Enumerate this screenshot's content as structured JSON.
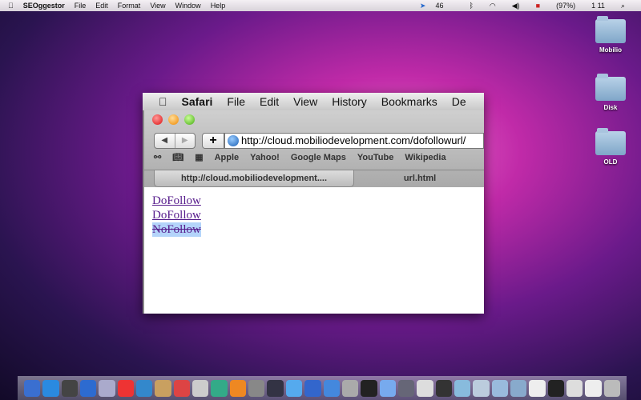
{
  "menubar": {
    "app": "SEOggestor",
    "items": [
      "File",
      "Edit",
      "Format",
      "View",
      "Window",
      "Help"
    ],
    "status": {
      "count": "46",
      "battery": "(97%)",
      "time": "1 11"
    }
  },
  "desktop": {
    "icons": [
      "Mobilio",
      "Disk",
      "OLD"
    ]
  },
  "safari": {
    "menu": [
      "Safari",
      "File",
      "Edit",
      "View",
      "History",
      "Bookmarks",
      "De"
    ],
    "url": "http://cloud.mobiliodevelopment.com/dofollowurl/",
    "bookmarks": [
      "Apple",
      "Yahoo!",
      "Google Maps",
      "YouTube",
      "Wikipedia"
    ],
    "tabs": [
      "http://cloud.mobiliodevelopment....",
      "url.html"
    ],
    "links": [
      "DoFollow",
      "DoFollow",
      "NoFollow"
    ]
  },
  "dock_colors": [
    "#3a6fd0",
    "#2a8ae0",
    "#444",
    "#2d6bd0",
    "#aac",
    "#e33",
    "#38c",
    "#c9a060",
    "#d44",
    "#ccc",
    "#3a8",
    "#e82",
    "#888",
    "#334",
    "#5ae",
    "#36c",
    "#48d",
    "#aaa",
    "#222",
    "#7ae",
    "#667",
    "#ddd",
    "#333",
    "#8bd",
    "#bcd",
    "#9bd",
    "#8ac",
    "#eee",
    "#222",
    "#ddd",
    "#eee",
    "#bbb"
  ]
}
